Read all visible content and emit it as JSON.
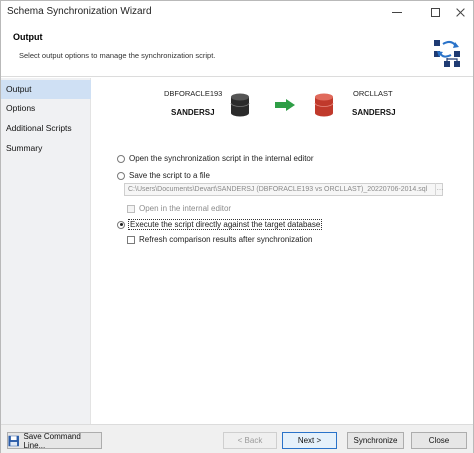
{
  "window": {
    "title": "Schema Synchronization Wizard"
  },
  "header": {
    "title": "Output",
    "subtitle": "Select output options to manage the synchronization script.",
    "icon": "schema-sync-icon"
  },
  "sidebar": {
    "items": [
      {
        "label": "Output",
        "active": true
      },
      {
        "label": "Options",
        "active": false
      },
      {
        "label": "Additional Scripts",
        "active": false
      },
      {
        "label": "Summary",
        "active": false
      }
    ]
  },
  "connections": {
    "source": {
      "label": "DBFORACLE193",
      "schema": "SANDERSJ",
      "icon": "source-database-icon"
    },
    "target": {
      "label": "ORCLLAST",
      "schema": "SANDERSJ",
      "icon": "target-database-icon"
    },
    "arrow_icon": "arrow-right-icon"
  },
  "output_options": {
    "open_in_editor": {
      "label": "Open the synchronization script in the internal editor",
      "selected": false
    },
    "save_to_file": {
      "label": "Save the script to a file",
      "selected": false,
      "path": "C:\\Users\\Documents\\Devart\\SANDERSJ (DBFORACLE193 vs ORCLLAST)_20220706-2014.sql",
      "open_in_internal_editor": {
        "label": "Open in the internal editor",
        "checked": false,
        "enabled": false
      }
    },
    "execute_directly": {
      "label": "Execute the script directly against the target database",
      "selected": true,
      "refresh_results": {
        "label": "Refresh comparison results after synchronization",
        "checked": false
      }
    }
  },
  "footer": {
    "save_command_line": "Save Command Line...",
    "back": "< Back",
    "next": "Next >",
    "synchronize": "Synchronize",
    "close": "Close"
  },
  "colors": {
    "sidebar_active": "#cfe0f4",
    "source_db": "#2b2b2b",
    "target_db": "#c0392b",
    "arrow": "#2e9e46",
    "primary_border": "#2a73c9"
  }
}
